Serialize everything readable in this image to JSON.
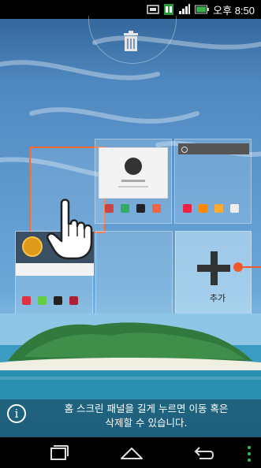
{
  "status_bar": {
    "time": "오후 8:50"
  },
  "panels": {
    "add_label": "추가"
  },
  "info": {
    "message_line1": "홈 스크린 패널을 길게 누르면 이동 혹은",
    "message_line2": "삭제할 수 있습니다."
  },
  "colors": {
    "selection": "#ff6a2a",
    "accent": "#f05a2a"
  }
}
